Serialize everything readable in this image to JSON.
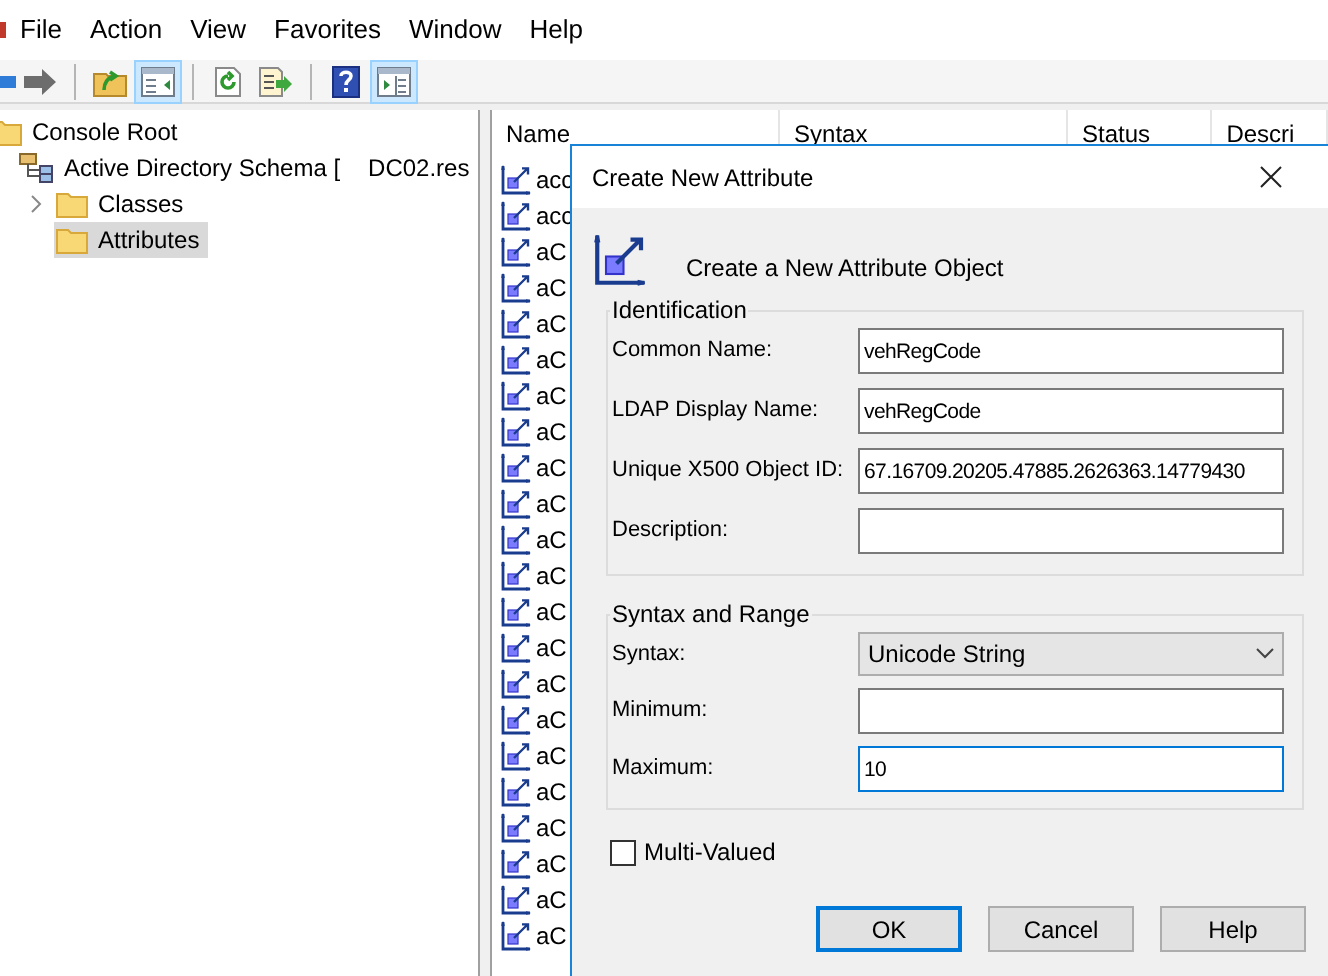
{
  "menu": [
    "File",
    "Action",
    "View",
    "Favorites",
    "Window",
    "Help"
  ],
  "toolbar": [
    {
      "kind": "back",
      "pressed": false
    },
    {
      "kind": "forward",
      "pressed": false
    },
    {
      "kind": "separator"
    },
    {
      "kind": "up",
      "pressed": false
    },
    {
      "kind": "tree",
      "pressed": true
    },
    {
      "kind": "separator"
    },
    {
      "kind": "refresh",
      "pressed": false
    },
    {
      "kind": "export",
      "pressed": false
    },
    {
      "kind": "separator"
    },
    {
      "kind": "help",
      "pressed": false
    },
    {
      "kind": "action_pane",
      "pressed": true
    }
  ],
  "tree": [
    {
      "label": "Console Root",
      "kind": "folder",
      "selected": false,
      "children": [
        {
          "label": "Active Directory Schema [",
          "server": "DC02.res",
          "kind": "schema",
          "selected": false,
          "children": [
            {
              "label": "Classes",
              "kind": "folder",
              "expandable": true,
              "selected": false
            },
            {
              "label": "Attributes",
              "kind": "folder",
              "expandable": false,
              "selected": true
            }
          ]
        }
      ]
    }
  ],
  "list": {
    "columns": [
      "Name",
      "Syntax",
      "Status",
      "Descri"
    ],
    "rows": [
      "acc",
      "acc",
      "aC",
      "aC",
      "aC",
      "aC",
      "aC",
      "aC",
      "aC",
      "aC",
      "aC",
      "aC",
      "aC",
      "aC",
      "aC",
      "aC",
      "aC",
      "aC",
      "aC",
      "aC",
      "aC",
      "aC"
    ]
  },
  "dialog": {
    "title": "Create New Attribute",
    "heading": "Create a New Attribute Object",
    "identification": {
      "title": "Identification",
      "fields": [
        {
          "label": "Common Name:",
          "value": "vehRegCode",
          "focused": false
        },
        {
          "label": "LDAP Display Name:",
          "value": "vehRegCode",
          "focused": false
        },
        {
          "label": "Unique X500 Object ID:",
          "value": "67.16709.20205.47885.2626363.14779430",
          "focused": false
        },
        {
          "label": "Description:",
          "focused": false
        }
      ]
    },
    "syntax_range": {
      "title": "Syntax and Range",
      "syntax": {
        "label": "Syntax:",
        "value": "Unicode String"
      },
      "fields": [
        {
          "label": "Minimum:",
          "focused": false
        },
        {
          "label": "Maximum:",
          "value": "10",
          "focused": true
        }
      ]
    },
    "multi_valued": {
      "label": "Multi-Valued",
      "checked": false
    },
    "buttons": [
      {
        "label": "OK",
        "default": true
      },
      {
        "label": "Cancel",
        "default": false
      },
      {
        "label": "Help",
        "default": false
      }
    ]
  }
}
